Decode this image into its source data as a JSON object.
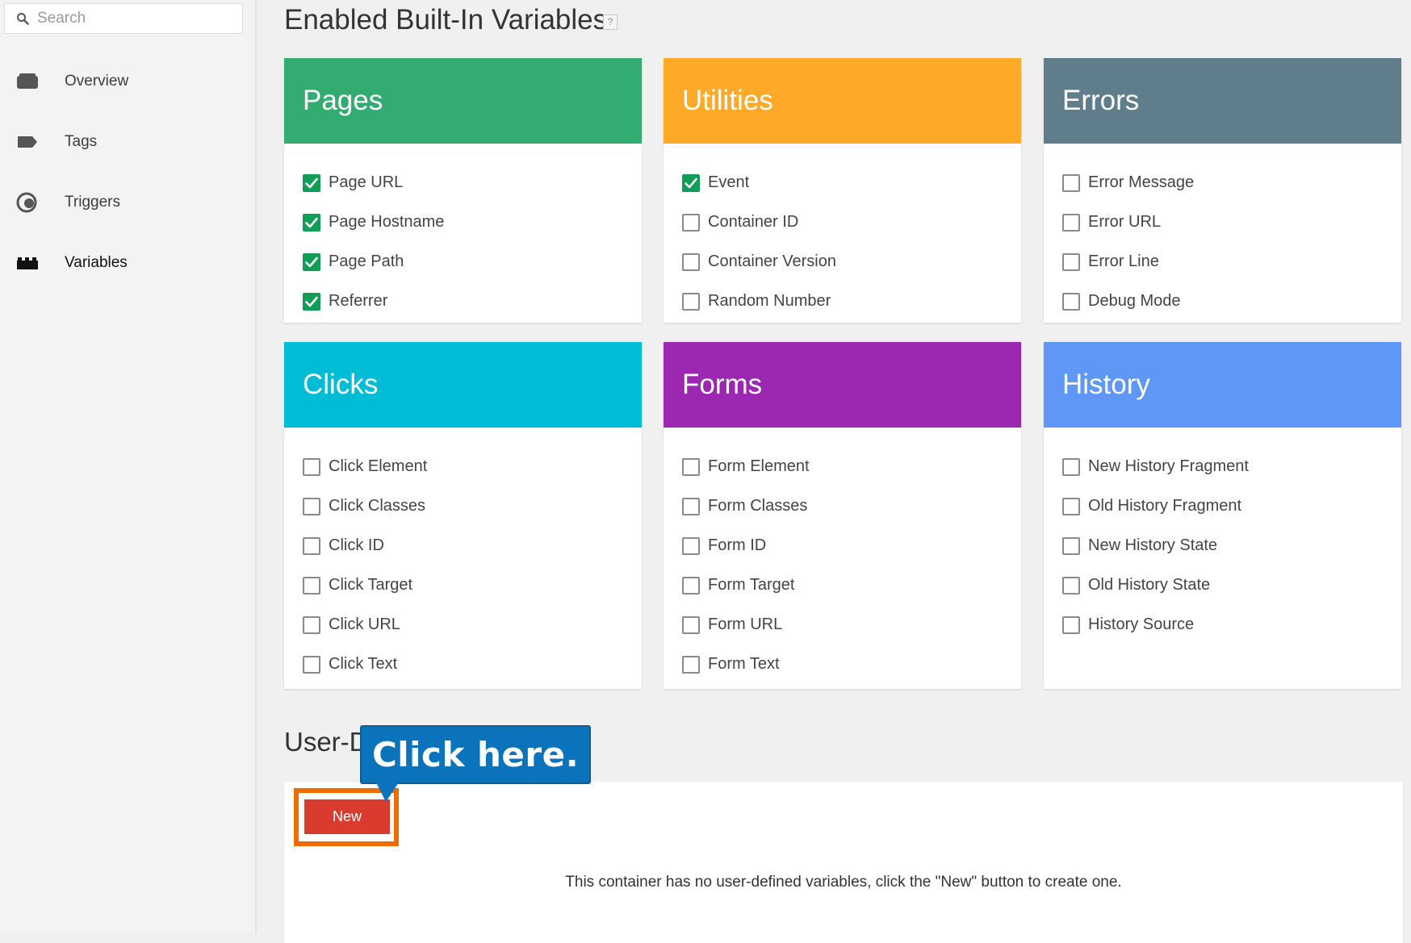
{
  "sidebar": {
    "search_placeholder": "Search",
    "items": [
      {
        "label": "Overview",
        "icon": "briefcase-icon"
      },
      {
        "label": "Tags",
        "icon": "tag-icon"
      },
      {
        "label": "Triggers",
        "icon": "trigger-icon"
      },
      {
        "label": "Variables",
        "icon": "blocks-icon",
        "active": true
      }
    ]
  },
  "main": {
    "title": "Enabled Built-In Variables",
    "help": "?",
    "cards": [
      {
        "title": "Pages",
        "color": "#33ac71",
        "items": [
          {
            "label": "Page URL",
            "checked": true
          },
          {
            "label": "Page Hostname",
            "checked": true
          },
          {
            "label": "Page Path",
            "checked": true
          },
          {
            "label": "Referrer",
            "checked": true
          }
        ]
      },
      {
        "title": "Utilities",
        "color": "#fea927",
        "items": [
          {
            "label": "Event",
            "checked": true
          },
          {
            "label": "Container ID",
            "checked": false
          },
          {
            "label": "Container Version",
            "checked": false
          },
          {
            "label": "Random Number",
            "checked": false
          }
        ]
      },
      {
        "title": "Errors",
        "color": "#607d8b",
        "items": [
          {
            "label": "Error Message",
            "checked": false
          },
          {
            "label": "Error URL",
            "checked": false
          },
          {
            "label": "Error Line",
            "checked": false
          },
          {
            "label": "Debug Mode",
            "checked": false
          }
        ]
      },
      {
        "title": "Clicks",
        "color": "#00bcd4",
        "items": [
          {
            "label": "Click Element",
            "checked": false
          },
          {
            "label": "Click Classes",
            "checked": false
          },
          {
            "label": "Click ID",
            "checked": false
          },
          {
            "label": "Click Target",
            "checked": false
          },
          {
            "label": "Click URL",
            "checked": false
          },
          {
            "label": "Click Text",
            "checked": false
          }
        ]
      },
      {
        "title": "Forms",
        "color": "#9c27b0",
        "items": [
          {
            "label": "Form Element",
            "checked": false
          },
          {
            "label": "Form Classes",
            "checked": false
          },
          {
            "label": "Form ID",
            "checked": false
          },
          {
            "label": "Form Target",
            "checked": false
          },
          {
            "label": "Form URL",
            "checked": false
          },
          {
            "label": "Form Text",
            "checked": false
          }
        ]
      },
      {
        "title": "History",
        "color": "#5e97f6",
        "items": [
          {
            "label": "New History Fragment",
            "checked": false
          },
          {
            "label": "Old History Fragment",
            "checked": false
          },
          {
            "label": "New History State",
            "checked": false
          },
          {
            "label": "Old History State",
            "checked": false
          },
          {
            "label": "History Source",
            "checked": false
          }
        ]
      }
    ],
    "user_defined": {
      "title": "User-D",
      "new_button": "New",
      "empty_message": "This container has no user-defined variables, click the \"New\" button to create one."
    },
    "callout": "Click here."
  },
  "colors": {
    "new_button": "#d93b2f",
    "highlight": "#ef6c00",
    "callout": "#0a73bb",
    "checkbox_checked": "#0f9d58"
  }
}
